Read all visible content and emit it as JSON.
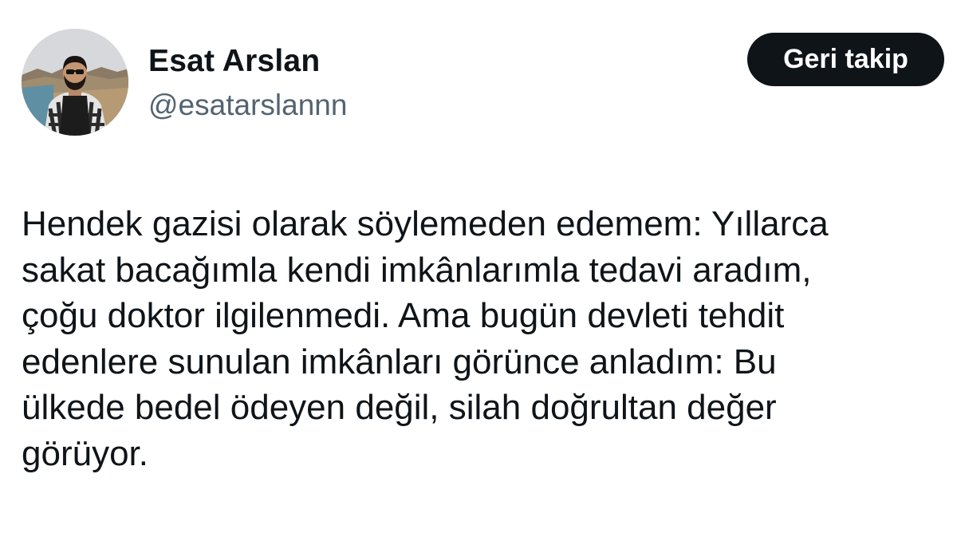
{
  "author": {
    "display_name": "Esat Arslan",
    "handle": "@esatarslannn"
  },
  "follow_button": {
    "label": "Geri takip"
  },
  "tweet": {
    "lines": [
      "Hendek gazisi olarak söylemeden edemem: Yıllarca",
      "sakat bacağımla kendi imkânlarımla tedavi aradım,",
      "çoğu doktor ilgilenmedi. Ama bugün devleti tehdit",
      "edenlere sunulan imkânları görünce anladım: Bu",
      "ülkede bedel ödeyen değil, silah doğrultan değer",
      "görüyor."
    ]
  },
  "colors": {
    "text_primary": "#0f1419",
    "text_secondary": "#536471",
    "button_bg": "#0f1419",
    "button_text": "#ffffff",
    "background": "#ffffff"
  }
}
